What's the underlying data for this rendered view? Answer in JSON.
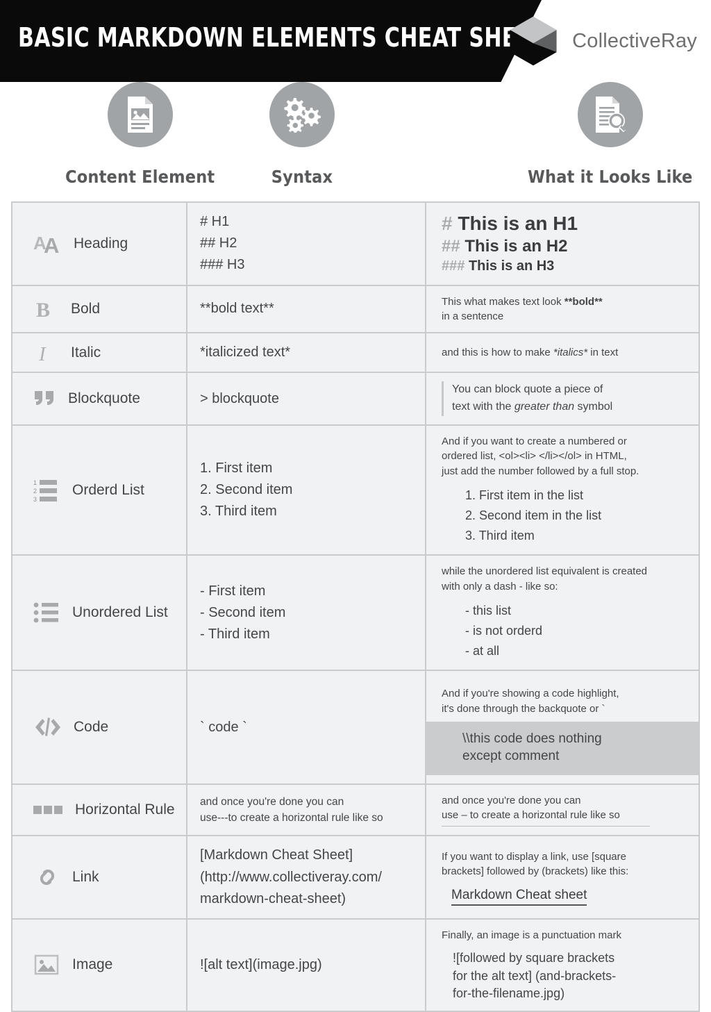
{
  "header": {
    "title": "BASIC MARKDOWN ELEMENTS CHEAT SHEET",
    "brand_name": "CollectiveRay",
    "logo_icon": "cube-logo-icon",
    "banner_color": "#0a0a0a"
  },
  "columns": [
    {
      "label": "Content Element",
      "icon": "document-image-icon"
    },
    {
      "label": "Syntax",
      "icon": "gears-icon"
    },
    {
      "label": "What it Looks Like",
      "icon": "document-magnifier-icon"
    }
  ],
  "colors": {
    "row_bg": "#f1f2f3",
    "border": "#c9cbcc",
    "icon_gray": "#a7a9ab",
    "text": "#44464a",
    "code_band": "#cbcccd"
  },
  "rows": {
    "heading": {
      "label": "Heading",
      "icon": "double-a-icon",
      "syntax": [
        "# H1",
        "## H2",
        "### H3"
      ],
      "preview": [
        {
          "hash": "#",
          "text": "This is an H1"
        },
        {
          "hash": "##",
          "text": "This is an H2"
        },
        {
          "hash": "###",
          "text": "This is an H3"
        }
      ]
    },
    "bold": {
      "label": "Bold",
      "icon": "bold-b-icon",
      "syntax": "**bold text**",
      "preview_pre": "This what makes text look ",
      "preview_strong": "**bold**",
      "preview_post": "in a sentence"
    },
    "italic": {
      "label": "Italic",
      "icon": "italic-i-icon",
      "syntax": "*italicized text*",
      "preview_pre": "and this is how to make ",
      "preview_em": "*italics*",
      "preview_post": " in text"
    },
    "blockquote": {
      "label": "Blockquote",
      "icon": "quote-marks-icon",
      "syntax": "> blockquote",
      "preview_line1": "You can block quote a piece of",
      "preview_pre2": "text with the ",
      "preview_em2": "greater than",
      "preview_post2": " symbol"
    },
    "ordered_list": {
      "label": "Orderd List",
      "icon": "numbered-list-icon",
      "syntax": [
        "1. First item",
        "2. Second item",
        "3. Third item"
      ],
      "preview_note": [
        "And if you want to create a numbered or",
        "ordered list, <ol><li> </li></ol> in HTML,",
        "just add the number followed by a full stop."
      ],
      "preview_items": [
        "1. First item in the list",
        "2. Second item in the list",
        "3. Third item"
      ]
    },
    "unordered_list": {
      "label": "Unordered List",
      "icon": "bullet-list-icon",
      "syntax": [
        "- First item",
        "- Second item",
        "- Third item"
      ],
      "preview_note": [
        "while the unordered list equivalent is created",
        "with only a dash - like so:"
      ],
      "preview_items": [
        "- this list",
        "- is not orderd",
        "- at all"
      ]
    },
    "code": {
      "label": "Code",
      "icon": "code-brackets-icon",
      "syntax": "` code `",
      "preview_note": [
        "And if you're showing a code highlight,",
        "it's done through the backquote or  `"
      ],
      "preview_code": [
        "\\\\this code does nothing",
        "except comment"
      ]
    },
    "horizontal_rule": {
      "label": "Horizontal Rule",
      "icon": "three-squares-icon",
      "syntax": [
        "and once you're done you can",
        "use---to create a horizontal rule like so"
      ],
      "preview_note": [
        "and once you're done you can"
      ],
      "preview_rule_text": "use – to create a horizontal rule like so"
    },
    "link": {
      "label": "Link",
      "icon": "chain-link-icon",
      "syntax": [
        "[Markdown Cheat Sheet]",
        "(http://www.collectiveray.com/",
        "markdown-cheat-sheet)"
      ],
      "preview_note": [
        "If you want to display a link, use [square",
        "brackets] followed by (brackets) like this:"
      ],
      "preview_link_text": "Markdown Cheat sheet"
    },
    "image": {
      "label": "Image",
      "icon": "picture-icon",
      "syntax": "![alt text](image.jpg)",
      "preview_note": [
        "Finally, an image is a punctuation mark"
      ],
      "preview_items": [
        "![followed by square brackets",
        "for the alt text] (and-brackets-",
        "for-the-filename.jpg)"
      ]
    }
  }
}
